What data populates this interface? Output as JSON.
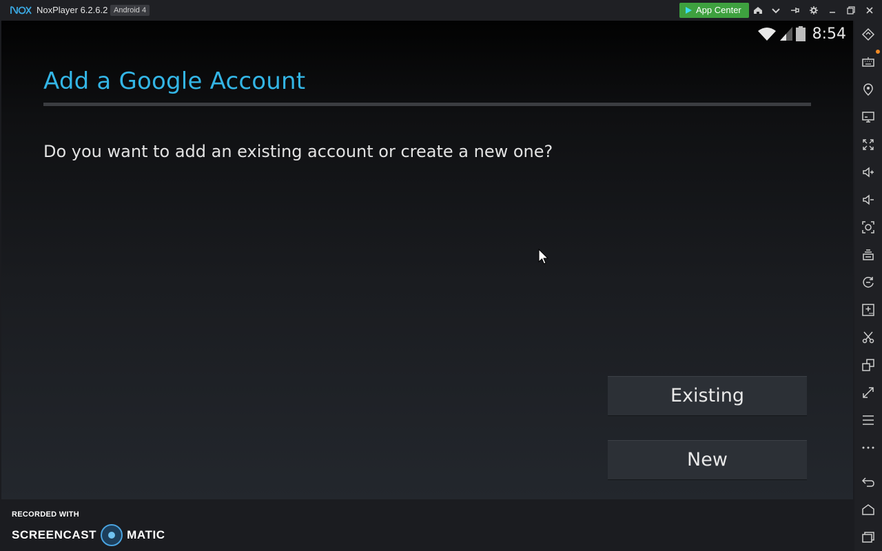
{
  "titlebar": {
    "app_name": "NoxPlayer 6.2.6.2",
    "android_badge": "Android 4",
    "app_center_label": "App Center",
    "icons": [
      "logo-icon",
      "home-icon",
      "dropdown-icon",
      "pin-icon",
      "settings-icon",
      "minimize-icon",
      "restore-icon",
      "close-icon"
    ]
  },
  "status_bar": {
    "time": "8:54",
    "icons": [
      "wifi-icon",
      "signal-icon",
      "battery-icon"
    ]
  },
  "dialog": {
    "title": "Add a Google Account",
    "question": "Do you want to add an existing account or create a new one?",
    "existing_label": "Existing",
    "new_label": "New"
  },
  "sidebar": {
    "icons": [
      "rotate-icon",
      "keyboard-icon",
      "location-icon",
      "screen-icon",
      "fullscreen-icon",
      "volume-up-icon",
      "volume-down-icon",
      "screenshot-icon",
      "multi-instance-icon",
      "sync-icon",
      "add-apk-icon",
      "scissors-icon",
      "multi-window-icon",
      "expand-icon",
      "menu-icon",
      "more-icon",
      "back-icon",
      "android-home-icon",
      "recent-apps-icon"
    ]
  },
  "watermark": {
    "recorded_with": "RECORDED WITH",
    "brand_left": "SCREENCAST",
    "brand_right": "MATIC"
  },
  "colors": {
    "accent": "#33b5e5",
    "app_center_bg": "#3ea13f",
    "notification_dot": "#f08a24"
  }
}
